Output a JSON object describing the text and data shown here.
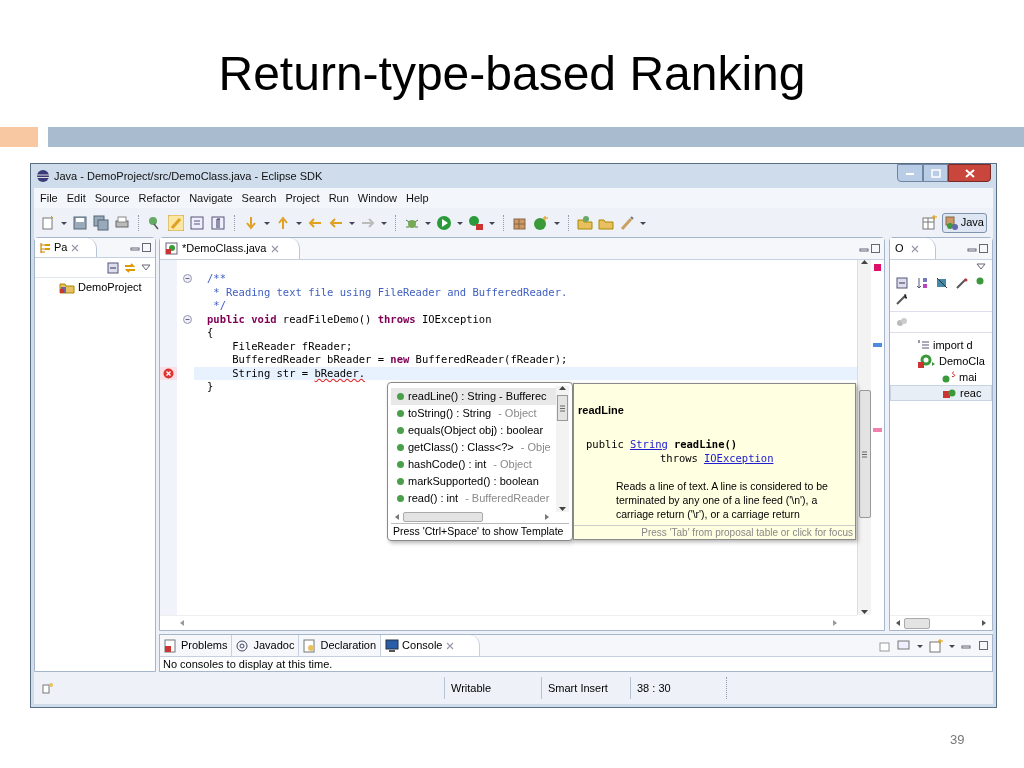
{
  "slide": {
    "title": "Return-type-based Ranking",
    "page_number": "39"
  },
  "window": {
    "title": "Java - DemoProject/src/DemoClass.java - Eclipse SDK"
  },
  "menu": [
    "File",
    "Edit",
    "Source",
    "Refactor",
    "Navigate",
    "Search",
    "Project",
    "Run",
    "Window",
    "Help"
  ],
  "perspective": {
    "label": "Java",
    "selected": true
  },
  "package_explorer": {
    "tab": "Pa",
    "items": [
      {
        "label": "DemoProject",
        "selected": false
      }
    ]
  },
  "editor": {
    "tab": "*DemoClass.java",
    "code_lines": [
      {
        "fold": true,
        "error": false,
        "current": false,
        "tokens": [
          {
            "kind": "comment",
            "text": "/**"
          }
        ]
      },
      {
        "fold": false,
        "error": false,
        "current": false,
        "tokens": [
          {
            "kind": "comment",
            "text": " * Reading text file using FileReader and BufferedReader."
          }
        ]
      },
      {
        "fold": false,
        "error": false,
        "current": false,
        "tokens": [
          {
            "kind": "comment",
            "text": " */"
          }
        ]
      },
      {
        "fold": true,
        "error": false,
        "current": false,
        "tokens": [
          {
            "kind": "keyword",
            "text": "public"
          },
          {
            "kind": "keyword",
            "text": " void"
          },
          {
            "kind": "plain",
            "text": " readFileDemo() "
          },
          {
            "kind": "keyword",
            "text": "throws"
          },
          {
            "kind": "plain",
            "text": " IOException"
          }
        ]
      },
      {
        "fold": false,
        "error": false,
        "current": false,
        "tokens": [
          {
            "kind": "plain",
            "text": "{"
          }
        ]
      },
      {
        "fold": false,
        "error": false,
        "current": false,
        "tokens": [
          {
            "kind": "plain",
            "text": "    FileReader fReader;"
          }
        ]
      },
      {
        "fold": false,
        "error": false,
        "current": false,
        "tokens": [
          {
            "kind": "plain",
            "text": "    BufferedReader bReader = "
          },
          {
            "kind": "keyword",
            "text": "new"
          },
          {
            "kind": "plain",
            "text": " BufferedReader(fReader);"
          }
        ]
      },
      {
        "fold": false,
        "error": true,
        "current": true,
        "tokens": [
          {
            "kind": "plain",
            "text": "    String str = "
          },
          {
            "kind": "error",
            "text": "bReader."
          }
        ]
      },
      {
        "fold": false,
        "error": false,
        "current": false,
        "tokens": [
          {
            "kind": "plain",
            "text": "}"
          }
        ]
      }
    ]
  },
  "proposals": {
    "items": [
      {
        "text": "readLine() : String - Bufferec",
        "selected": true
      },
      {
        "text": "toString() : String",
        "qualifier": "- Object",
        "selected": false
      },
      {
        "text": "equals(Object obj) : boolear",
        "selected": false
      },
      {
        "text": "getClass() : Class<?>",
        "qualifier": "- Obje",
        "selected": false
      },
      {
        "text": "hashCode() : int",
        "qualifier": "- Object",
        "selected": false
      },
      {
        "text": "markSupported() : boolean",
        "selected": false
      },
      {
        "text": "read() : int",
        "qualifier": "- BufferedReader",
        "selected": false
      }
    ],
    "footer": "Press 'Ctrl+Space' to show Template"
  },
  "javadoc": {
    "title": "readLine",
    "signature": [
      [
        {
          "kind": "plain",
          "text": "public"
        },
        {
          "kind": "link",
          "text": "String"
        },
        {
          "kind": "bold",
          "text": "readLine()"
        }
      ],
      [
        {
          "kind": "plain",
          "text": "throws"
        },
        {
          "kind": "link",
          "text": "IOException"
        }
      ]
    ],
    "description": "Reads a line of text. A line is considered to be terminated by any one of a line feed ('\\n'), a carriage return ('\\r'), or a carriage return",
    "footer": "Press 'Tab' from proposal table or click for focus"
  },
  "outline": {
    "tab": "O",
    "items": [
      {
        "label": "import d",
        "kind": "imports",
        "selected": false
      },
      {
        "label": "DemoCla",
        "kind": "class",
        "selected": false,
        "children": [
          {
            "label": "mai",
            "kind": "static-method",
            "selected": false
          },
          {
            "label": "reac",
            "kind": "method",
            "selected": true
          }
        ]
      }
    ]
  },
  "bottom_tabs": [
    {
      "label": "Problems",
      "selected": false
    },
    {
      "label": "Javadoc",
      "selected": false
    },
    {
      "label": "Declaration",
      "selected": false
    },
    {
      "label": "Console",
      "selected": true
    }
  ],
  "console_message": "No consoles to display at this time.",
  "status_bar": [
    "Writable",
    "Smart Insert",
    "38 : 30"
  ]
}
